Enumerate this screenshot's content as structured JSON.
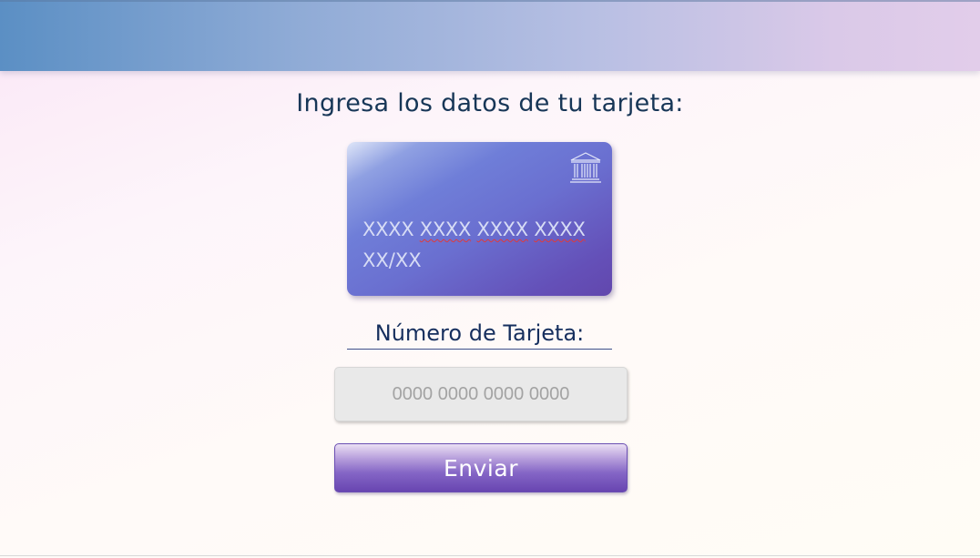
{
  "page": {
    "title": "Ingresa los datos de tu tarjeta:"
  },
  "card_preview": {
    "number_groups": [
      "XXXX",
      "XXXX",
      "XXXX",
      "XXXX"
    ],
    "expiry": "XX/XX",
    "icon": "bank-icon"
  },
  "form": {
    "card_number_label": "Número de Tarjeta:",
    "card_number_placeholder": "0000 0000 0000 0000",
    "card_number_value": "",
    "submit_label": "Enviar"
  },
  "colors": {
    "title_text": "#173657",
    "label_text": "#162f5e",
    "card_gradient_end": "#6247ad",
    "button_gradient_end": "#6845b1",
    "input_background": "#e9e9e9"
  }
}
